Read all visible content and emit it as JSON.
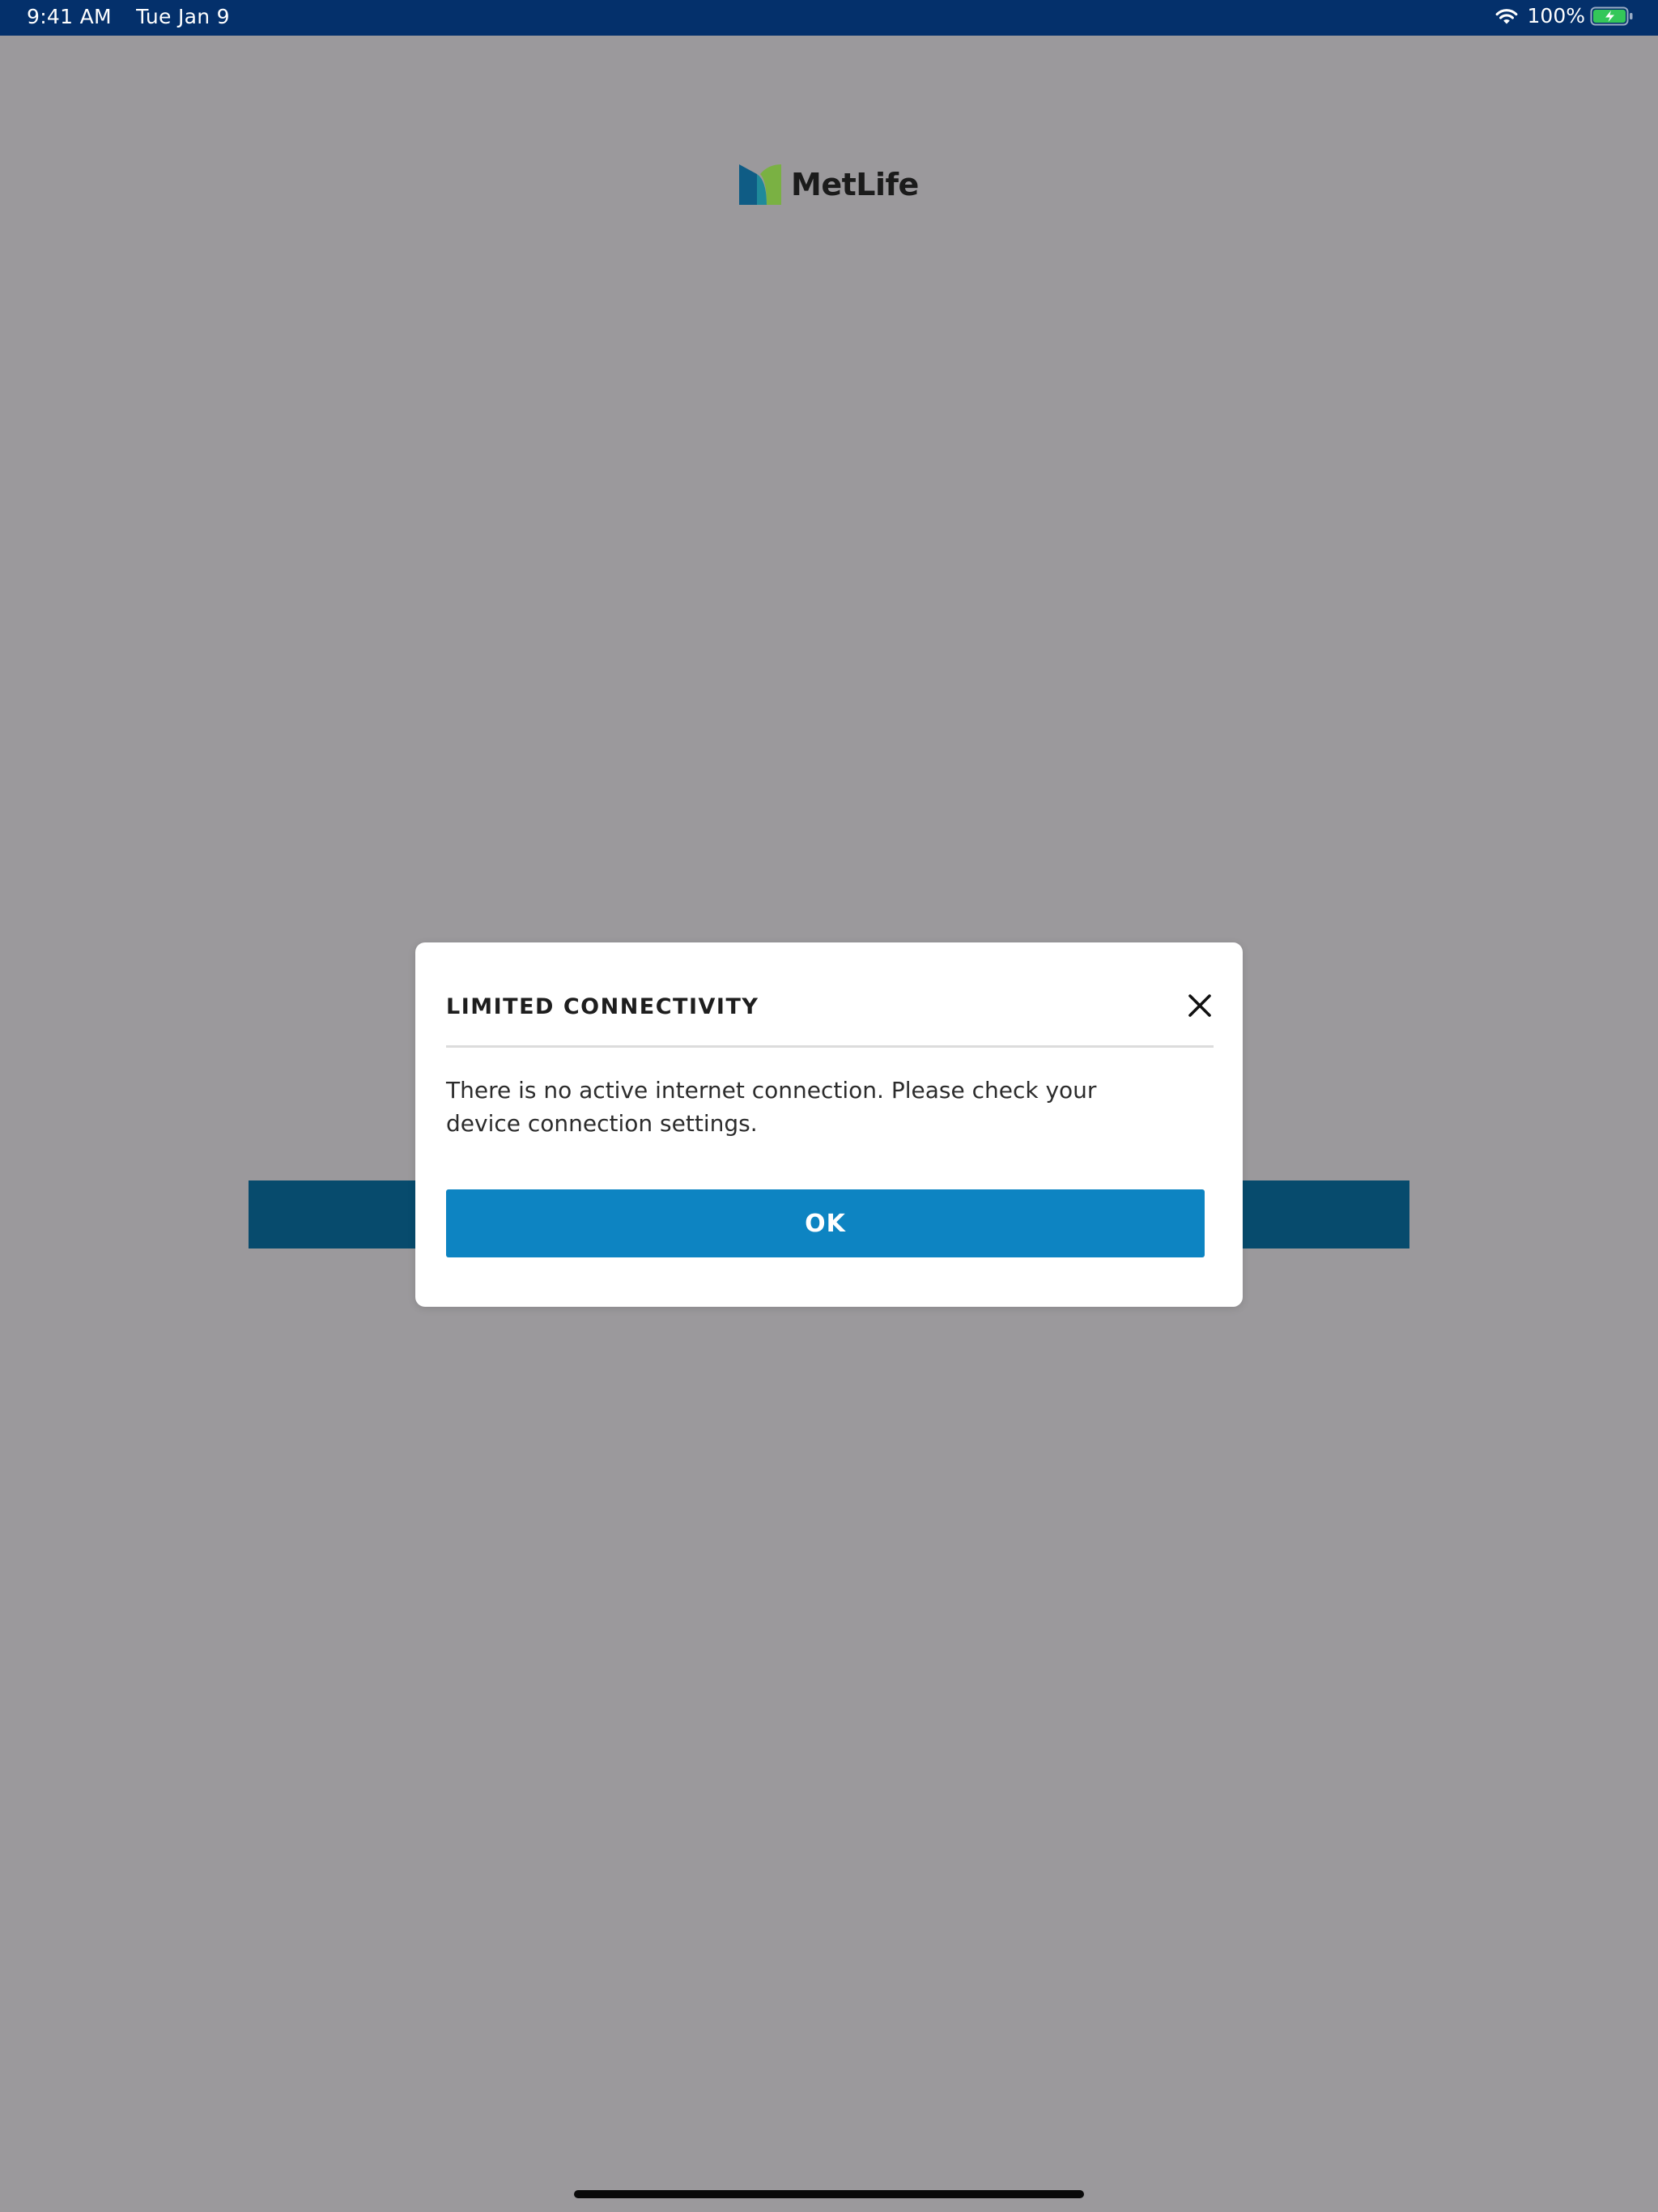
{
  "status_bar": {
    "time": "9:41 AM",
    "date": "Tue Jan 9",
    "battery_percent": "100%",
    "battery_level": 1.0,
    "charging": true,
    "wifi_icon": "wifi-icon",
    "battery_icon": "battery-charging-icon"
  },
  "logo": {
    "text": "MetLife",
    "icon": "metlife-logo-icon",
    "colors": {
      "dark_blue": "#0f5c85",
      "teal": "#1f8a9a",
      "green": "#7ab143"
    }
  },
  "modal": {
    "title": "LIMITED CONNECTIVITY",
    "message": "There is no active internet connection. Please check your device connection settings.",
    "ok_label": "OK",
    "close_icon": "close-icon"
  },
  "colors": {
    "status_bar_bg": "#04306b",
    "overlay_bg": "#9b999c",
    "primary_button": "#0d84c2",
    "background_button": "#074b6d",
    "battery_fill": "#34c759"
  }
}
